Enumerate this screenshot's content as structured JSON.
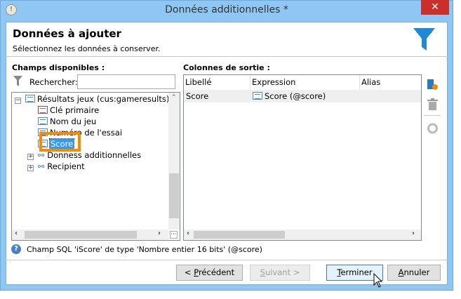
{
  "window": {
    "title": "Données additionnelles *",
    "close_label": "✕"
  },
  "header": {
    "title": "Données à ajouter",
    "subtitle": "Sélectionnez les données à conserver.",
    "icon": "funnel-icon"
  },
  "left": {
    "label": "Champs disponibles :",
    "search_label": "Rechercher:",
    "search_value": "",
    "tree": {
      "root": "Résultats jeux (cus:gameresults)",
      "children": [
        "Clé primaire",
        "Nom du jeu",
        "Numéro de l'essai",
        "Score"
      ],
      "selected": "Score",
      "links": [
        "Donness additionnelles",
        "Recipient"
      ]
    }
  },
  "right": {
    "label": "Colonnes de sortie :",
    "columns": [
      "Libellé",
      "Expression",
      "Alias"
    ],
    "rows": [
      {
        "libelle": "Score",
        "expression": "Score (@score)",
        "alias": ""
      }
    ]
  },
  "info": "Champ SQL 'iScore' de type 'Nombre entier 16 bits' (@score)",
  "buttons": {
    "prev": {
      "prefix": "< ",
      "key": "P",
      "rest": "récédent"
    },
    "next": {
      "key": "S",
      "rest": "uivant >"
    },
    "finish": {
      "key": "T",
      "rest": "erminer"
    },
    "cancel": {
      "key": "A",
      "rest": "nnuler"
    }
  },
  "colors": {
    "frame": "#8fc7f4",
    "accent": "#1e8ad6",
    "highlight": "#f28c00",
    "selection": "#3399ff"
  }
}
